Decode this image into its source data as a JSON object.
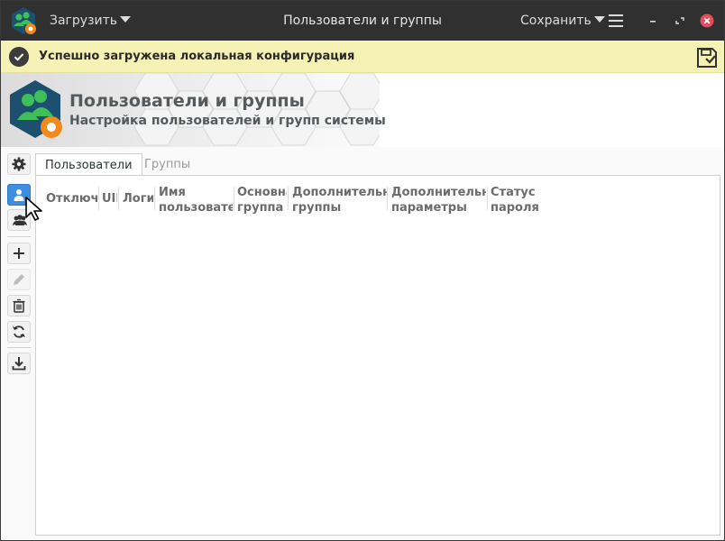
{
  "titlebar": {
    "load_label": "Загрузить",
    "title": "Пользователи и группы",
    "save_label": "Сохранить"
  },
  "infobar": {
    "message": "Успешно загружена локальная конфигурация"
  },
  "header": {
    "title": "Пользователи и группы",
    "subtitle": "Настройка пользователей и групп системы"
  },
  "sidebar": {
    "items": [
      "settings-icon",
      "user-icon",
      "group-icon",
      "add-icon",
      "edit-icon",
      "delete-icon",
      "refresh-icon",
      "download-icon"
    ],
    "active": "user-icon"
  },
  "tabs": [
    {
      "label": "Пользователи",
      "active": true
    },
    {
      "label": "Группы",
      "active": false
    }
  ],
  "table": {
    "columns": [
      "Отключен",
      "UID",
      "Логин",
      "Имя пользователя",
      "Основная группа",
      "Дополнительные группы",
      "Дополнительные параметры",
      "Статус пароля"
    ],
    "rows": []
  },
  "colors": {
    "titlebar": "#303030",
    "infobar": "#f6f2b5",
    "accent": "#3d8ee0",
    "brand_green": "#2ea84a",
    "brand_orange": "#f08a1c"
  }
}
